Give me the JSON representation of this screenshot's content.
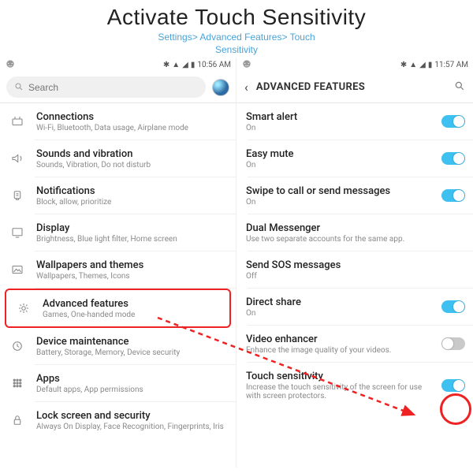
{
  "header": {
    "title": "Activate Touch Sensitivity",
    "breadcrumb_line1": "Settings> Advanced Features> Touch",
    "breadcrumb_line2": "Sensitivity"
  },
  "left": {
    "status": {
      "time": "10:56 AM"
    },
    "search": {
      "placeholder": "Search"
    },
    "items": [
      {
        "title": "Connections",
        "sub": "Wi-Fi, Bluetooth, Data usage, Airplane mode",
        "icon": "connections"
      },
      {
        "title": "Sounds and vibration",
        "sub": "Sounds, Vibration, Do not disturb",
        "icon": "sound"
      },
      {
        "title": "Notifications",
        "sub": "Block, allow, prioritize",
        "icon": "notifications"
      },
      {
        "title": "Display",
        "sub": "Brightness, Blue light filter, Home screen",
        "icon": "display"
      },
      {
        "title": "Wallpapers and themes",
        "sub": "Wallpapers, Themes, Icons",
        "icon": "wallpaper"
      },
      {
        "title": "Advanced features",
        "sub": "Games, One-handed mode",
        "icon": "advanced",
        "highlight": true
      },
      {
        "title": "Device maintenance",
        "sub": "Battery, Storage, Memory, Device security",
        "icon": "maintenance"
      },
      {
        "title": "Apps",
        "sub": "Default apps, App permissions",
        "icon": "apps"
      },
      {
        "title": "Lock screen and security",
        "sub": "Always On Display, Face Recognition, Fingerprints, Iris",
        "icon": "lock"
      }
    ]
  },
  "right": {
    "status": {
      "time": "11:57 AM"
    },
    "title": "ADVANCED FEATURES",
    "items": [
      {
        "title": "Smart alert",
        "sub": "On",
        "toggle": "on"
      },
      {
        "title": "Easy mute",
        "sub": "On",
        "toggle": "on"
      },
      {
        "title": "Swipe to call or send messages",
        "sub": "On",
        "toggle": "on"
      },
      {
        "title": "Dual Messenger",
        "sub": "Use two separate accounts for the same app."
      },
      {
        "title": "Send SOS messages",
        "sub": "Off"
      },
      {
        "title": "Direct share",
        "sub": "On",
        "toggle": "on"
      },
      {
        "title": "Video enhancer",
        "sub": "Enhance the image quality of your videos.",
        "toggle": "off"
      },
      {
        "title": "Touch sensitivity",
        "sub": "Increase the touch sensitivity of the screen for use with screen protectors.",
        "toggle": "on",
        "circled": true
      }
    ]
  }
}
